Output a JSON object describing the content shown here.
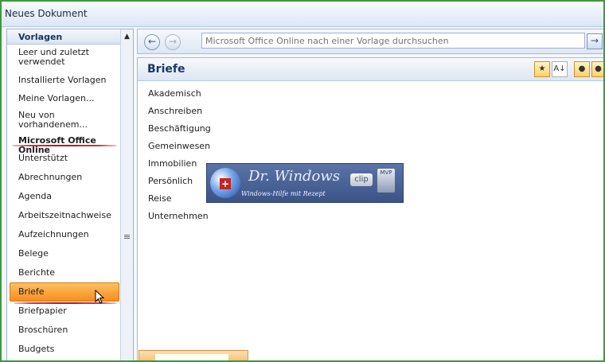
{
  "window": {
    "title": "Neues Dokument"
  },
  "sidebar": {
    "heading": "Vorlagen",
    "items": [
      "Leer und zuletzt verwendet",
      "Installierte Vorlagen",
      "Meine Vorlagen...",
      "Neu von vorhandenem...",
      "Microsoft Office Online",
      "Unterstützt",
      "Abrechnungen",
      "Agenda",
      "Arbeitszeitnachweise",
      "Aufzeichnungen",
      "Belege",
      "Berichte",
      "Briefe",
      "Briefpapier",
      "Broschüren",
      "Budgets"
    ],
    "selected": "Briefe"
  },
  "navbar": {
    "search_placeholder": "Microsoft Office Online nach einer Vorlage durchsuchen"
  },
  "content": {
    "title": "Briefe",
    "items": [
      "Akademisch",
      "Anschreiben",
      "Beschäftigung",
      "Gemeinwesen",
      "Immobilien",
      "Persönlich",
      "Reise",
      "Unternehmen"
    ]
  },
  "watermark": {
    "title": "Dr. Windows",
    "subtitle": "Windows-Hilfe mit Rezept",
    "badge": "clip",
    "badge2": "MVP"
  },
  "colors": {
    "frame_border": "#3c9a3c",
    "selected_bg": "#f78d1e",
    "annotation": "#c21414"
  }
}
